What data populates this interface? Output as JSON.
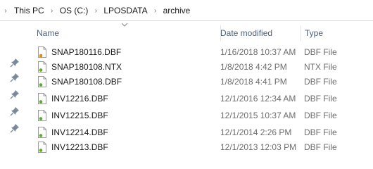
{
  "breadcrumb": [
    "This PC",
    "OS (C:)",
    "LPOSDATA",
    "archive"
  ],
  "columns": {
    "name": "Name",
    "date_modified": "Date modified",
    "type": "Type"
  },
  "sort": {
    "column": "name",
    "direction": "descending"
  },
  "files": [
    {
      "name": "SNAP180116.DBF",
      "date": "1/16/2018 10:37 AM",
      "type": "DBF File",
      "icon": "dbf-file-orange-icon"
    },
    {
      "name": "SNAP180108.NTX",
      "date": "1/8/2018 4:42 PM",
      "type": "NTX File",
      "icon": "ntx-file-icon"
    },
    {
      "name": "SNAP180108.DBF",
      "date": "1/8/2018 4:41 PM",
      "type": "DBF File",
      "icon": "dbf-file-icon"
    },
    {
      "name": "INV12216.DBF",
      "date": "12/1/2016 12:34 AM",
      "type": "DBF File",
      "icon": "dbf-file-icon"
    },
    {
      "name": "INV12215.DBF",
      "date": "12/1/2015 10:37 AM",
      "type": "DBF File",
      "icon": "dbf-file-icon"
    },
    {
      "name": "INV12214.DBF",
      "date": "12/1/2014 2:26 PM",
      "type": "DBF File",
      "icon": "dbf-file-icon"
    },
    {
      "name": "INV12213.DBF",
      "date": "12/1/2013 12:03 PM",
      "type": "DBF File",
      "icon": "dbf-file-icon"
    }
  ],
  "pinned_nav_items": 5,
  "colors": {
    "header_text": "#4c607a",
    "secondary_text": "#6d6d6d",
    "icon_green": "#5fa829",
    "icon_orange": "#e58a18"
  }
}
